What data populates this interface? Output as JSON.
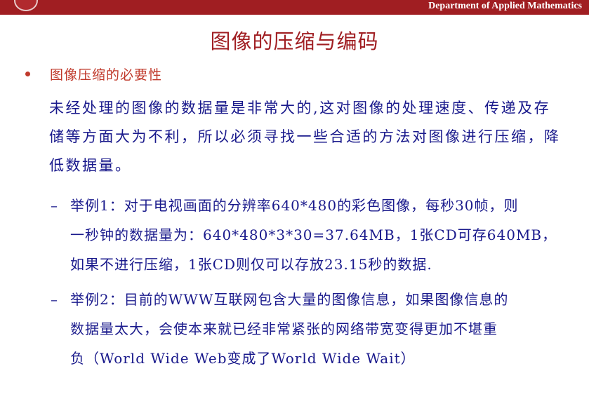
{
  "header": {
    "department": "Department of Applied Mathematics"
  },
  "slide": {
    "title": "图像的压缩与编码",
    "bullet": "图像压缩的必要性",
    "paragraph_lines": [
      "未经处理的图像的数据量是非常大的,这对图像的处理速度、传递及存",
      "储等方面大为不利，所以必须寻找一些合适的方法对图像进行压缩，降",
      "低数据量。"
    ],
    "examples": [
      {
        "dash": "–",
        "lines": [
          "举例1：对于电视画面的分辨率640*480的彩色图像，每秒30帧，则",
          "一秒钟的数据量为：640*480*3*30=37.64MB，1张CD可存640MB，",
          "如果不进行压缩，1张CD则仅可以存放23.15秒的数据."
        ]
      },
      {
        "dash": "–",
        "lines": [
          "举例2：目前的WWW互联网包含大量的图像信息，如果图像信息的",
          "数据量太大，会使本来就已经非常紧张的网络带宽变得更加不堪重",
          "负（World Wide Web变成了World Wide Wait）"
        ]
      }
    ]
  },
  "colors": {
    "header_bar": "#a01e22",
    "title": "#a01e22",
    "bullet": "#c0392b",
    "body_text": "#1a1a8c"
  }
}
